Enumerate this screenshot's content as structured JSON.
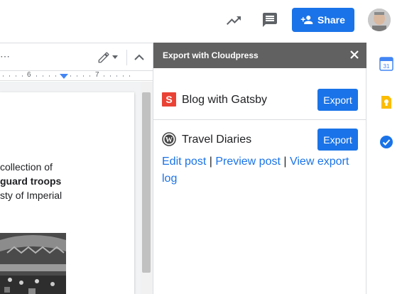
{
  "topbar": {
    "share_label": "Share",
    "icons": [
      "trending-icon",
      "comment-icon",
      "person-add-icon",
      "avatar"
    ]
  },
  "doc_toolbar": {
    "overflow_label": "⋯",
    "icons": [
      "pencil-icon",
      "chevron-down-icon",
      "collapse-icon"
    ]
  },
  "ruler": {
    "labels": [
      "6",
      "7"
    ]
  },
  "document": {
    "lines": [
      "collection of",
      "guard troops",
      "sty of Imperial"
    ]
  },
  "panel": {
    "title": "Export with Cloudpress",
    "sites": [
      {
        "name": "Blog with Gatsby",
        "icon": "gatsby-s-icon",
        "icon_color": "#ea4335",
        "export_label": "Export"
      },
      {
        "name": "Travel Diaries",
        "icon": "wordpress-icon",
        "export_label": "Export",
        "links": {
          "edit": "Edit post",
          "preview": "Preview post",
          "view_log": "View export log",
          "separator": "|"
        }
      }
    ]
  },
  "sidebar": {
    "icons": [
      "calendar-icon",
      "keep-icon",
      "tasks-icon"
    ],
    "calendar_day": "31"
  },
  "colors": {
    "accent": "#1a73e8",
    "panel_header": "#616161",
    "keep_yellow": "#fbbc04",
    "gatsby_red": "#ea4335"
  }
}
